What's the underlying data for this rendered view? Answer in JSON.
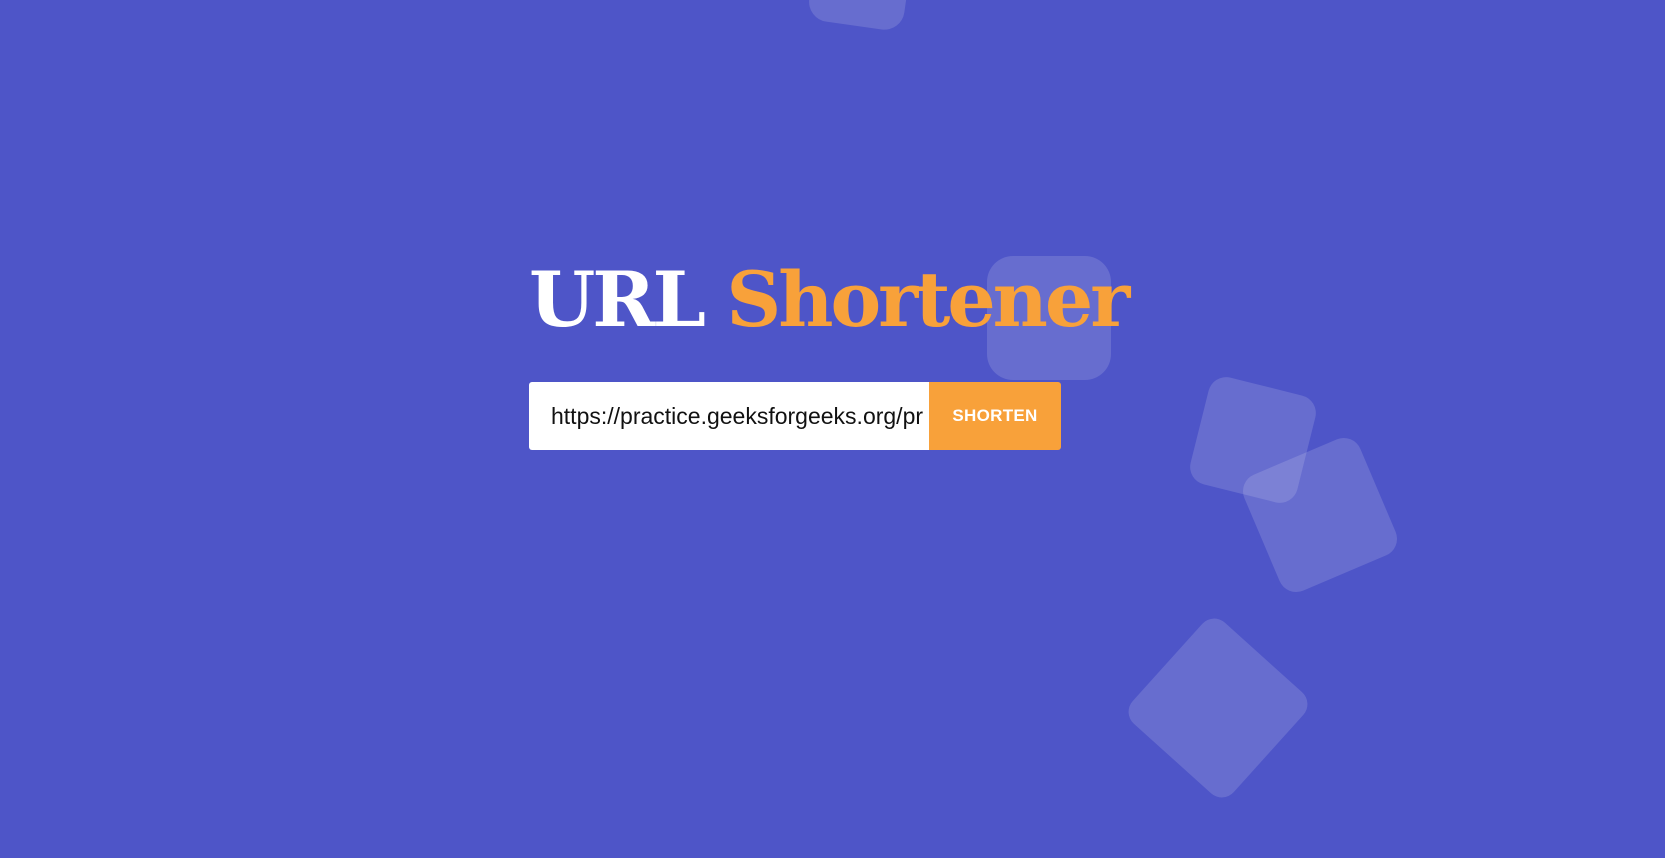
{
  "title": {
    "part1": "URL",
    "part2": "Shortener"
  },
  "form": {
    "url_value": "https://practice.geeksforgeeks.org/problems",
    "button_label": "SHORTEN"
  },
  "colors": {
    "background": "#4e55c8",
    "accent": "#f8a13a",
    "title_primary": "#ffffff"
  }
}
